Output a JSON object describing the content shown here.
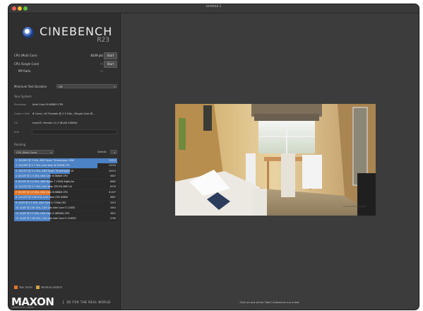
{
  "window": {
    "title": "Untitled 1"
  },
  "logo": {
    "name": "CINEBENCH",
    "version": "R23"
  },
  "tests": [
    {
      "label": "CPU (Multi Core)",
      "value": "8149 pts",
      "button": "Start"
    },
    {
      "label": "CPU (Single Core)",
      "value": "---",
      "button": "Start"
    },
    {
      "label": "MP Ratio",
      "value": "---"
    }
  ],
  "min_test": {
    "label": "Minimum Test Duration",
    "value": "Off"
  },
  "system": {
    "section": "Your System",
    "rows": [
      {
        "key": "Processor",
        "value": "Intel Core i9-9880H CPU"
      },
      {
        "key": "Cores x GHz",
        "value": "8 Cores, 16 Threads @ 2.3 GHz, (Single Core @..."
      },
      {
        "key": "OS",
        "value": "macOS: Version 11.2 (Build 20D64)"
      },
      {
        "key": "Info",
        "value": ""
      }
    ]
  },
  "ranking": {
    "section": "Ranking",
    "dropdown": "CPU (Multi Core)",
    "details": "Details",
    "rows": [
      {
        "name": "1. 32C/64T @ 3 GHz, AMD Ryzen Threadripper 2990",
        "score": "30054",
        "fraction": 1.0,
        "highlight": false
      },
      {
        "name": "2. 24C/48T @ 2.7 GHz, Intel Xeon W-3265M CPU",
        "score": "24243",
        "fraction": 0.81,
        "highlight": false
      },
      {
        "name": "3. 16C/32T @ 3.4 GHz, AMD Ryzen Threadripper 19",
        "score": "16315",
        "fraction": 0.54,
        "highlight": false
      },
      {
        "name": "4. 8C/16T @ 2.3 GHz, Intel Core i9-9880H CPU",
        "score": "9087",
        "fraction": 0.3,
        "highlight": false
      },
      {
        "name": "5. 8C/16T @ 3.4 GHz, AMD Ryzen 7 1700X Eight-Cor",
        "score": "8889",
        "fraction": 0.3,
        "highlight": false
      },
      {
        "name": "6. 12C/24T @ 2.7 GHz, Intel Xeon CPU E5-2697 v2",
        "score": "8378",
        "fraction": 0.28,
        "highlight": false
      },
      {
        "name": "7. 8C/16T @ 2.3 GHz, Intel Core i9-9880H CPU",
        "score": "8149*",
        "fraction": 0.27,
        "highlight": true
      },
      {
        "name": "8. 12C/24T @ 2.66 GHz, Intel Xeon CPU X5650",
        "score": "6867",
        "fraction": 0.23,
        "highlight": false
      },
      {
        "name": "9. 4C/8T @ 4.2 GHz, Intel Core i7-7700K CPU",
        "score": "5553",
        "fraction": 0.18,
        "highlight": false
      },
      {
        "name": "10. 4C/8T @ 2.81 GHz, 11th Gen Intel Core i7-1165G",
        "score": "4904",
        "fraction": 0.16,
        "highlight": false
      },
      {
        "name": "11. 4C/8T @ 2.3 GHz, Intel Core i7-4850HQ CPU",
        "score": "3891",
        "fraction": 0.13,
        "highlight": false
      },
      {
        "name": "12. 4C/8T @ 1.69 GHz, 11th Gen Intel Core i7-1165G7",
        "score": "3769",
        "fraction": 0.13,
        "highlight": false
      }
    ]
  },
  "legend": {
    "your_score": "Your Score",
    "identical": "Identical System"
  },
  "colors": {
    "bar": "#4c82c6",
    "highlight": "#e2762a",
    "bg": "#2f2f2f"
  },
  "footer": {
    "brand": "MAXON",
    "brand_sub": "A NEMETSCHEK COMPANY",
    "tagline": "3D FOR THE REAL WORLD"
  },
  "status": "Click on one of the 'Start' buttons to run a test.",
  "render": {
    "watermark": "www.renderbaron.de"
  }
}
